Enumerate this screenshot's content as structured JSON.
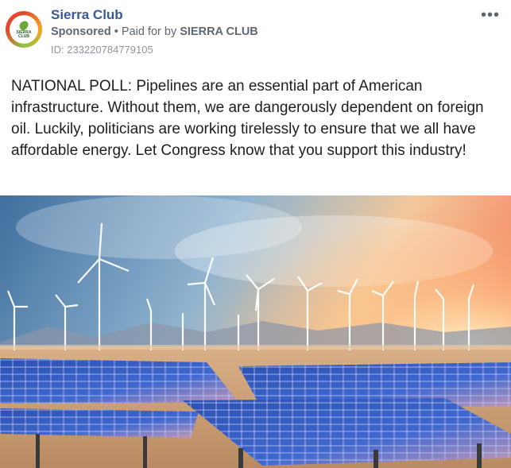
{
  "header": {
    "page_name": "Sierra Club",
    "sponsored": "Sponsored",
    "paid_for_prefix": "Paid for by",
    "paid_for_by": "SIERRA CLUB",
    "ad_id": "ID: 233220784779105",
    "avatar_text": "SIERRA CLUB",
    "more_icon": "•••"
  },
  "post": {
    "text": "NATIONAL POLL: Pipelines are an essential part of American infrastructure. Without them, we are dangerously dependent on foreign oil. Luckily, politicians are working tirelessly to ensure that we all have affordable energy. Let Congress know that you support this industry!"
  },
  "image": {
    "icon": "solar-panels-wind-turbines-photo",
    "colors": {
      "sky_top": "#4a7db0",
      "sky_warm": "#f6b07a",
      "sun": "#ffd48a",
      "panel": "#3456b8",
      "ground": "#c99a6a"
    }
  }
}
